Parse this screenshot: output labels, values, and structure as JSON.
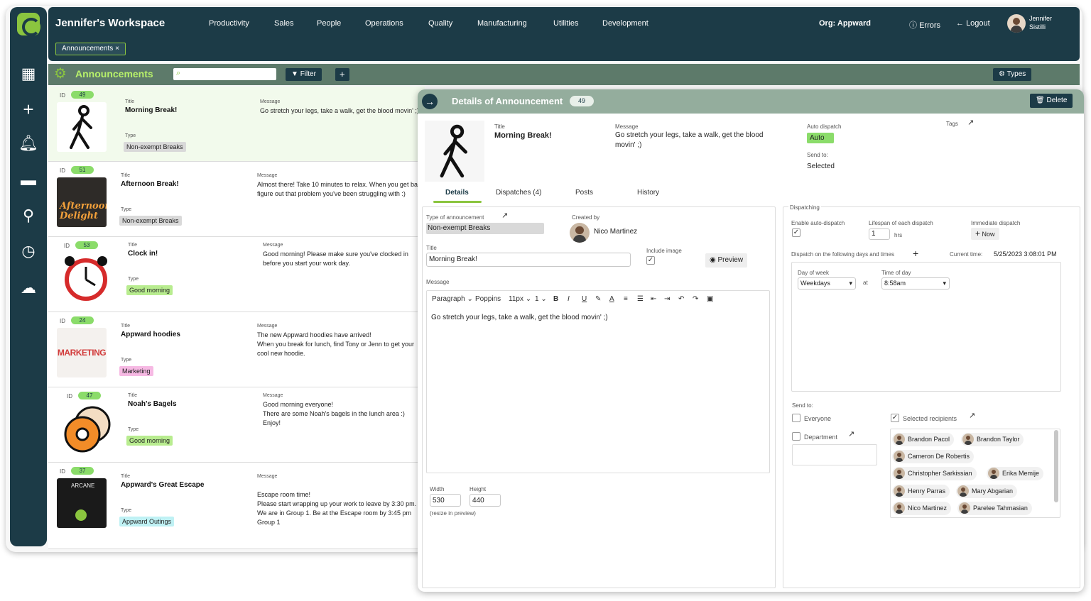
{
  "workspace": "Jennifer's Workspace",
  "nav": [
    "Productivity",
    "Sales",
    "People",
    "Operations",
    "Quality",
    "Manufacturing",
    "Utilities",
    "Development"
  ],
  "org_label": "Org:",
  "org_value": "Appward",
  "errors": "Errors",
  "logout": "Logout",
  "user_first": "Jennifer",
  "user_last": "Sistilli",
  "open_tab": "Announcements",
  "toolbar": {
    "title": "Announcements",
    "filter": "Filter",
    "add": "+",
    "types": "Types",
    "search_placeholder": ""
  },
  "list_labels": {
    "id": "ID",
    "title": "Title",
    "type": "Type",
    "message": "Message"
  },
  "rows": [
    {
      "id": "49",
      "title": "Morning Break!",
      "type": "Non-exempt Breaks",
      "type_color": "#d9d9d9",
      "message": "Go stretch your legs, take a walk, get the blood movin' ;)"
    },
    {
      "id": "51",
      "title": "Afternoon Break!",
      "type": "Non-exempt Breaks",
      "type_color": "#d9d9d9",
      "message": "Almost there! Take 10 minutes to relax. When you get back figure out that problem you've been struggling with :)"
    },
    {
      "id": "53",
      "title": "Clock in!",
      "type": "Good morning",
      "type_color": "#b8ec8f",
      "message": "Good morning! Please make sure you've clocked in before you start your work day."
    },
    {
      "id": "24",
      "title": "Appward hoodies",
      "type": "Marketing",
      "type_color": "#f6b9e3",
      "message": "The new Appward hoodies have arrived!\nWhen you break for lunch, find Tony or Jenn to get your cool new hoodie."
    },
    {
      "id": "47",
      "title": "Noah's Bagels",
      "type": "Good morning",
      "type_color": "#b8ec8f",
      "message": "Good morning everyone!\nThere are some Noah's bagels in the lunch area :)\nEnjoy!"
    },
    {
      "id": "37",
      "title": "Appward's Great Escape",
      "type": "Appward Outings",
      "type_color": "#bff1f4",
      "message": "\nEscape room time!\nPlease start wrapping up your work to leave by 3:30 pm. We are in Group 1. Be at the Escape room by 3:45 pm\nGroup 1"
    }
  ],
  "thumb_texts": {
    "afternoon": "Afternoon Delight",
    "marketing": "MARKETING",
    "escape": "ARCANE"
  },
  "details": {
    "header": "Details of Announcement",
    "id": "49",
    "delete": "Delete",
    "title_label": "Title",
    "title": "Morning Break!",
    "message_label": "Message",
    "message": "Go stretch your legs, take a walk, get the blood movin' ;)",
    "tags_label": "Tags",
    "auto_dispatch_label": "Auto dispatch",
    "auto_dispatch": "Auto",
    "send_to_label": "Send to:",
    "send_to": "Selected",
    "tabs": [
      "Details",
      "Dispatches (4)",
      "Posts",
      "History"
    ],
    "type_label": "Type of announcement",
    "type_value": "Non-exempt Breaks",
    "created_by_label": "Created by",
    "created_by": "Nico Martinez",
    "include_image_label": "Include image",
    "preview": "Preview",
    "editor": {
      "paragraph": "Paragraph",
      "font": "Poppins",
      "size": "11px",
      "line": "1"
    },
    "width_label": "Width",
    "width": "530",
    "height_label": "Height",
    "height": "440",
    "resize_note": "(resize in preview)"
  },
  "dispatching": {
    "section": "Dispatching",
    "enable_label": "Enable auto-dispatch",
    "lifespan_label": "Lifespan of each dispatch",
    "lifespan": "1",
    "hrs": "hrs",
    "immediate_label": "Immediate dispatch",
    "now": "Now",
    "days_label": "Dispatch on the following days and times",
    "current_time_label": "Current time:",
    "current_time": "5/25/2023 3:08:01 PM",
    "day_of_week_label": "Day of week",
    "day_of_week": "Weekdays",
    "at": "at",
    "time_of_day_label": "Time of day",
    "time_of_day": "8:58am",
    "send_to_label": "Send to:",
    "everyone": "Everyone",
    "selected_recipients": "Selected recipients",
    "department": "Department",
    "recipients": [
      "Brandon Pacol",
      "Brandon Taylor",
      "Cameron De Robertis",
      "Christopher Sarkissian",
      "Erika Memije",
      "Henry Parras",
      "Mary Abgarian",
      "Nico Martinez",
      "Parelee Tahmasian"
    ]
  }
}
